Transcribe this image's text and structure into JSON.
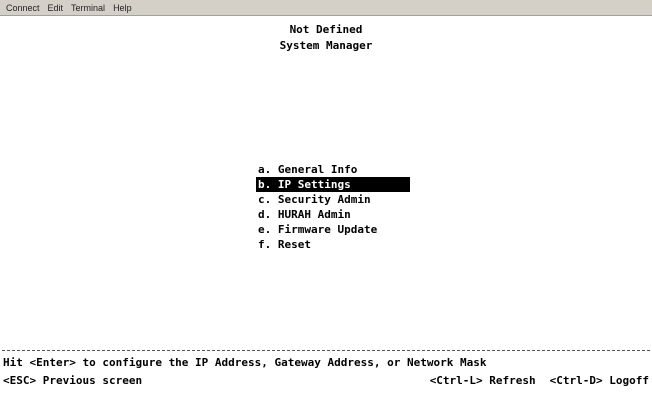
{
  "menubar": {
    "items": [
      "Connect",
      "Edit",
      "Terminal",
      "Help"
    ]
  },
  "header": {
    "line1": "Not Defined",
    "line2": "System Manager"
  },
  "menu": {
    "items": [
      {
        "label": "a. General Info"
      },
      {
        "label": "b. IP Settings"
      },
      {
        "label": "c. Security Admin"
      },
      {
        "label": "d. HURAH Admin"
      },
      {
        "label": "e. Firmware Update"
      },
      {
        "label": "f. Reset"
      }
    ],
    "selected_label": "b. IP Settings"
  },
  "status": {
    "message": "Hit <Enter> to configure the IP Address, Gateway Address, or Network Mask"
  },
  "footer": {
    "esc": "<ESC> Previous screen",
    "refresh": "<Ctrl-L> Refresh",
    "logoff": "<Ctrl-D> Logoff"
  }
}
